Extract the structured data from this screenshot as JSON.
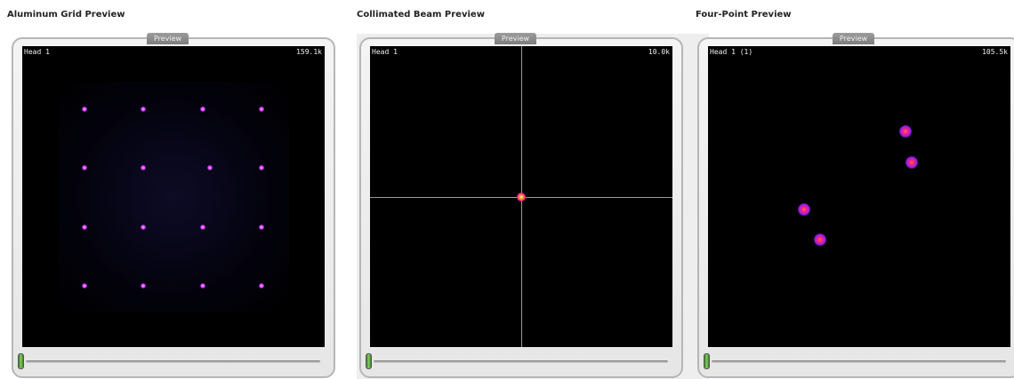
{
  "panels": [
    {
      "heading": "Aluminum Grid Preview",
      "tab": "Preview",
      "head_label": "Head 1",
      "count": "159.1k",
      "spot_count": 16
    },
    {
      "heading": "Collimated Beam Preview",
      "tab": "Preview",
      "head_label": "Head 1",
      "count": "10.0k",
      "spot_count": 1
    },
    {
      "heading": "Four-Point Preview",
      "tab": "Preview",
      "head_label": "Head 1 (1)",
      "count": "105.5k",
      "spot_count": 4
    }
  ],
  "slider_position": [
    0,
    0,
    0
  ],
  "colors": {
    "display_background": "#000000",
    "spot_core": "#ff2080",
    "spot_halo": "#a020e0",
    "slider_thumb": "#86d060"
  },
  "icons": [
    "slider-thumb-icon"
  ]
}
